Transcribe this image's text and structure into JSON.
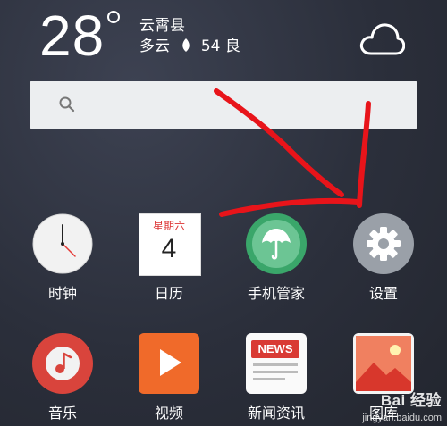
{
  "weather": {
    "temperature": "28",
    "location": "云霄县",
    "condition": "多云",
    "aqi": "54",
    "aqi_level": "良",
    "icon": "cloud-icon"
  },
  "search": {
    "icon": "search-icon",
    "placeholder": ""
  },
  "apps_row1": [
    {
      "label": "时钟",
      "icon": "clock-icon"
    },
    {
      "label": "日历",
      "icon": "calendar-icon",
      "weekday": "星期六",
      "date": "4"
    },
    {
      "label": "手机管家",
      "icon": "phone-manager-icon"
    },
    {
      "label": "设置",
      "icon": "settings-gear-icon"
    }
  ],
  "apps_row2": [
    {
      "label": "音乐",
      "icon": "music-icon"
    },
    {
      "label": "视频",
      "icon": "video-play-icon"
    },
    {
      "label": "新闻资讯",
      "icon": "news-icon",
      "badge": "NEWS"
    },
    {
      "label": "图库",
      "icon": "gallery-icon"
    }
  ],
  "watermark": {
    "text": "Bai 经验",
    "sub": "jingyan.baidu.com"
  },
  "colors": {
    "annotation_red": "#e8141a",
    "manager_green": "#4fb87a",
    "settings_gray": "#9aa0a8",
    "music_red": "#d9443c",
    "video_orange": "#f06a2a"
  }
}
